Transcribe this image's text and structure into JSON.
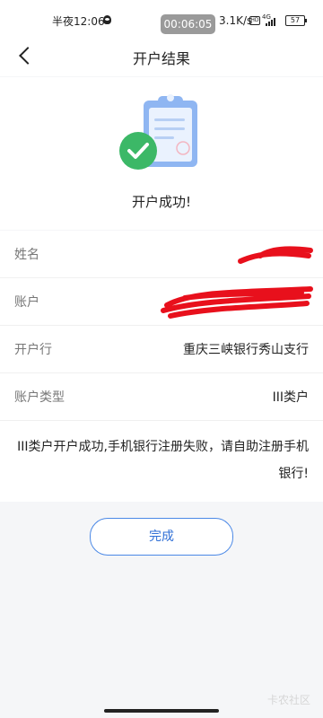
{
  "status_bar": {
    "time": "半夜12:06",
    "timer": "00:06:05",
    "net_speed": "3.1K/s",
    "hd": "HD",
    "net_type": "4G",
    "battery": "57"
  },
  "nav": {
    "title": "开户结果"
  },
  "result": {
    "message": "开户成功!"
  },
  "info": {
    "name_label": "姓名",
    "account_label": "账户",
    "bank_label": "开户行",
    "bank_value": "重庆三峡银行秀山支行",
    "type_label": "账户类型",
    "type_value": "III类户",
    "notice": "III类户开户成功,手机银行注册失败，请自助注册手机银行!"
  },
  "actions": {
    "done_label": "完成"
  },
  "watermark": "卡农社区",
  "colors": {
    "accent": "#4a88e6",
    "success": "#3cb867",
    "redaction": "#e8101c",
    "background": "#f5f6f8"
  }
}
